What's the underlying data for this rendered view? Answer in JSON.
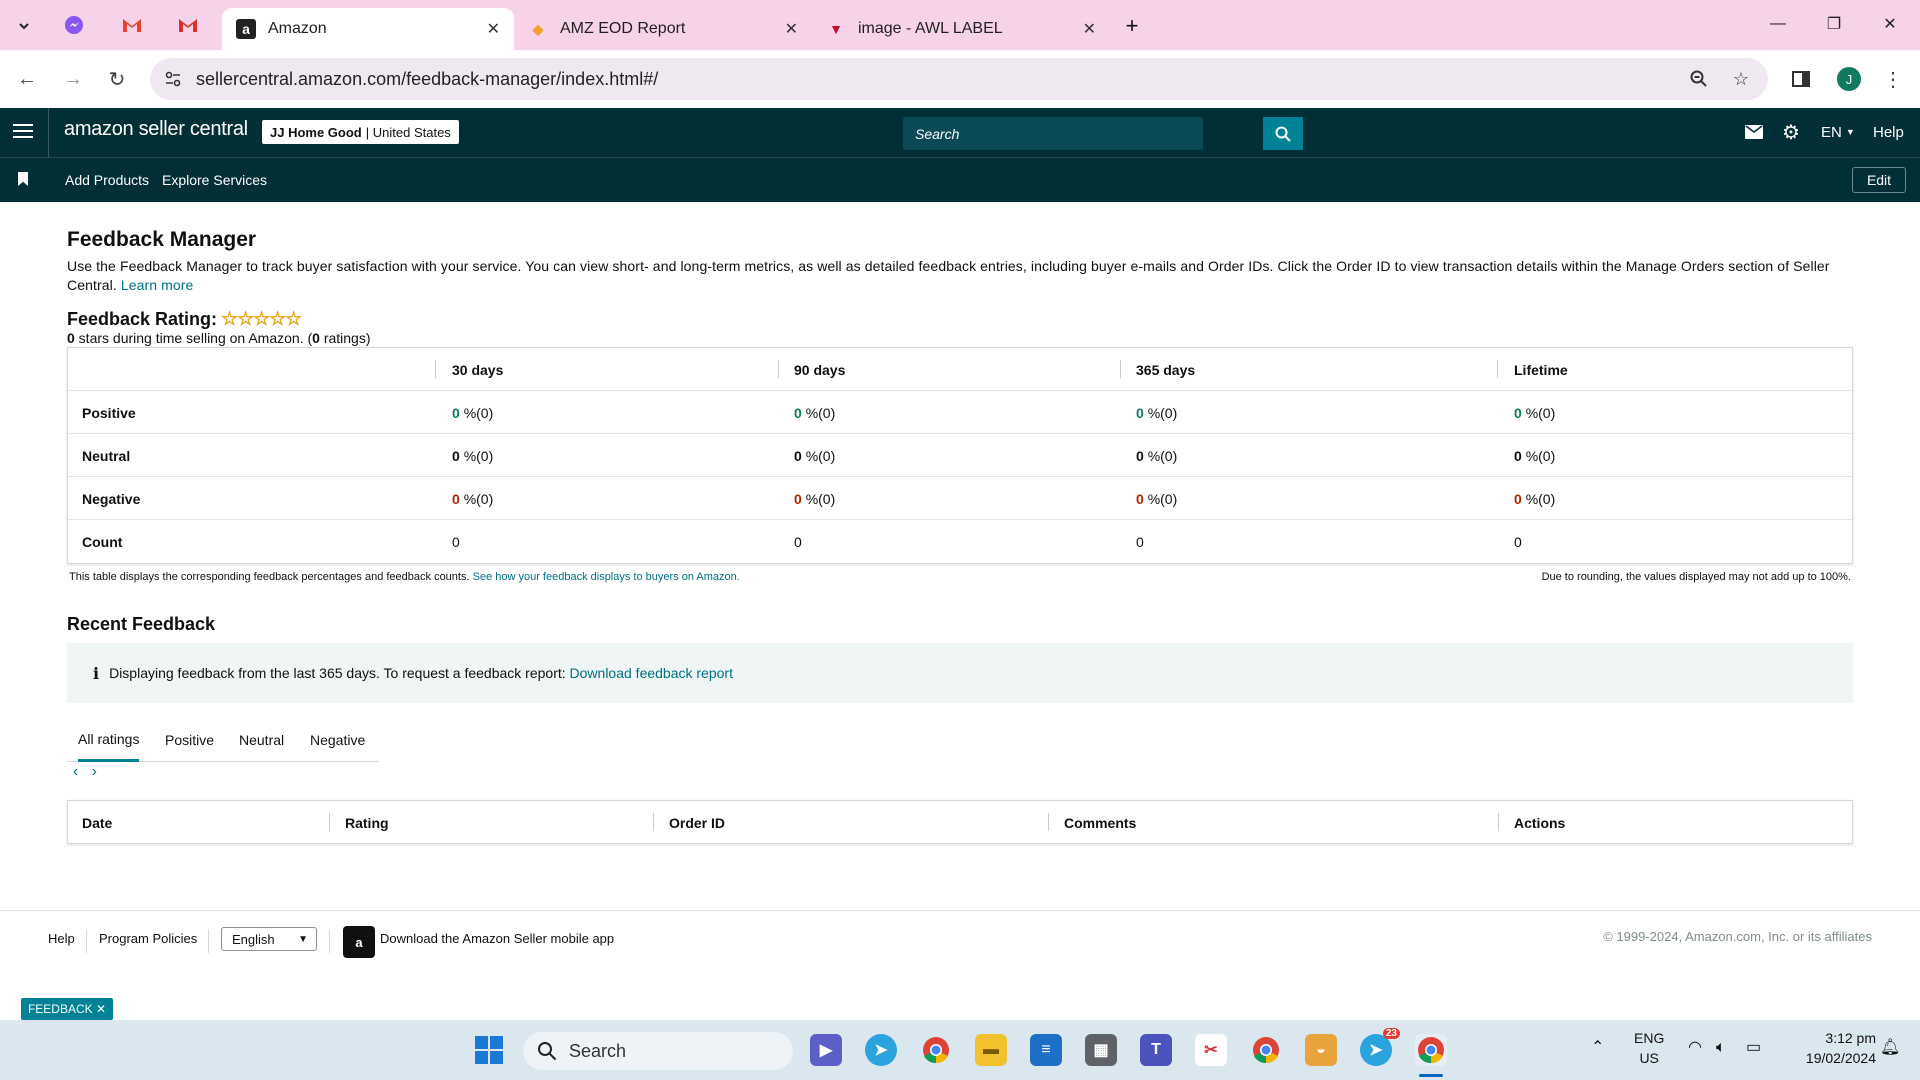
{
  "browser": {
    "tabs": [
      {
        "title": "Amazon",
        "active": true
      },
      {
        "title": "AMZ EOD Report",
        "active": false
      },
      {
        "title": "image - AWL LABEL",
        "active": false
      }
    ],
    "pinned_icons": [
      "messenger-icon",
      "gmail-icon",
      "gmail-icon"
    ],
    "url": "sellercentral.amazon.com/feedback-manager/index.html#/",
    "profile_initial": "J"
  },
  "header": {
    "logo": "amazon seller central",
    "store_name": "JJ Home Good",
    "store_region": "United States",
    "search_placeholder": "Search",
    "language": "EN",
    "help": "Help"
  },
  "subnav": {
    "links": [
      "Add Products",
      "Explore Services"
    ],
    "edit": "Edit"
  },
  "page": {
    "title": "Feedback Manager",
    "description": "Use the Feedback Manager to track buyer satisfaction with your service. You can view short- and long-term metrics, as well as detailed feedback entries, including buyer e-mails and Order IDs. Click the Order ID to view transaction details within the Manage Orders section of Seller Central.",
    "learn_more": "Learn more",
    "rating_title": "Feedback Rating:",
    "rating_stars_count": "0",
    "rating_text_middle": " stars during time selling on Amazon. (",
    "rating_count": "0",
    "rating_text_end": " ratings)"
  },
  "feedback_table": {
    "columns": [
      "30 days",
      "90 days",
      "365 days",
      "Lifetime"
    ],
    "rows": [
      {
        "label": "Positive",
        "values": [
          "0",
          "0",
          "0",
          "0"
        ],
        "suffix": "%(0)"
      },
      {
        "label": "Neutral",
        "values": [
          "0",
          "0",
          "0",
          "0"
        ],
        "suffix": "%(0)"
      },
      {
        "label": "Negative",
        "values": [
          "0",
          "0",
          "0",
          "0"
        ],
        "suffix": "%(0)"
      },
      {
        "label": "Count",
        "values": [
          "0",
          "0",
          "0",
          "0"
        ],
        "suffix": ""
      }
    ],
    "note_left": "This table displays the corresponding feedback percentages and feedback counts.",
    "note_left_link": "See how your feedback displays to buyers on Amazon.",
    "note_right": "Due to rounding, the values displayed may not add up to 100%."
  },
  "recent": {
    "title": "Recent Feedback",
    "info": "Displaying feedback from the last 365 days. To request a feedback report:",
    "info_link": "Download feedback report",
    "tabs": [
      "All ratings",
      "Positive",
      "Neutral",
      "Negative"
    ],
    "columns": [
      "Date",
      "Rating",
      "Order ID",
      "Comments",
      "Actions"
    ]
  },
  "footer": {
    "help": "Help",
    "policies": "Program Policies",
    "language": "English",
    "app_text": "Download the Amazon Seller mobile app",
    "copyright": "© 1999-2024, Amazon.com, Inc. or its affiliates",
    "feedback_tag": "FEEDBACK"
  },
  "taskbar": {
    "search": "Search",
    "lang": "ENG",
    "region": "US",
    "time": "3:12 pm",
    "date": "19/02/2024",
    "telegram_badge": "23"
  }
}
